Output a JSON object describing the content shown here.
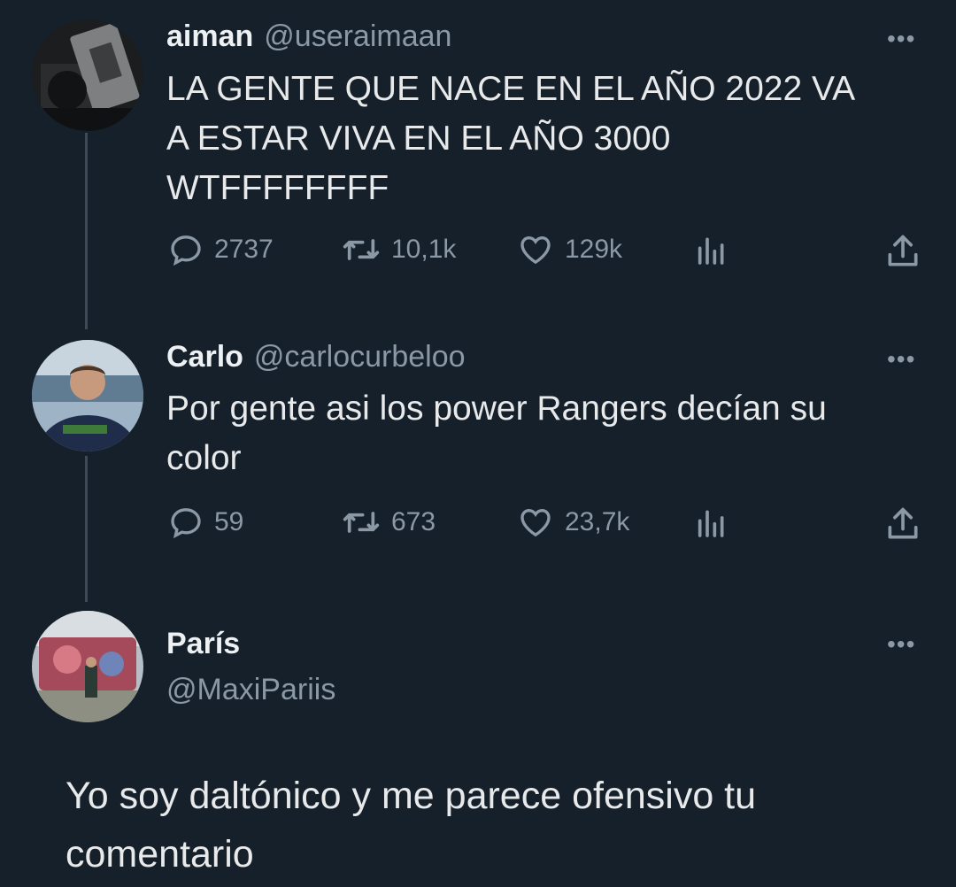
{
  "tweets": [
    {
      "name": "aiman",
      "handle": "@useraimaan",
      "text_lines": [
        "LA GENTE QUE NACE EN EL AÑO 2022 VA",
        "A ESTAR VIVA EN EL AÑO 3000",
        "WTFFFFFFFF"
      ],
      "replies": "2737",
      "retweets": "10,1k",
      "likes": "129k"
    },
    {
      "name": "Carlo",
      "handle": "@carlocurbeloo",
      "text_lines": [
        "Por gente asi los power Rangers decían su",
        "color"
      ],
      "replies": "59",
      "retweets": "673",
      "likes": "23,7k"
    },
    {
      "name": "París",
      "handle": "@MaxiPariis",
      "text_lines": [
        "Yo soy daltónico y me parece ofensivo tu",
        "comentario"
      ]
    }
  ],
  "more_label": "•••",
  "colors": {
    "background": "#15202b",
    "text": "#e7e9ea",
    "secondary": "#8b98a5"
  }
}
